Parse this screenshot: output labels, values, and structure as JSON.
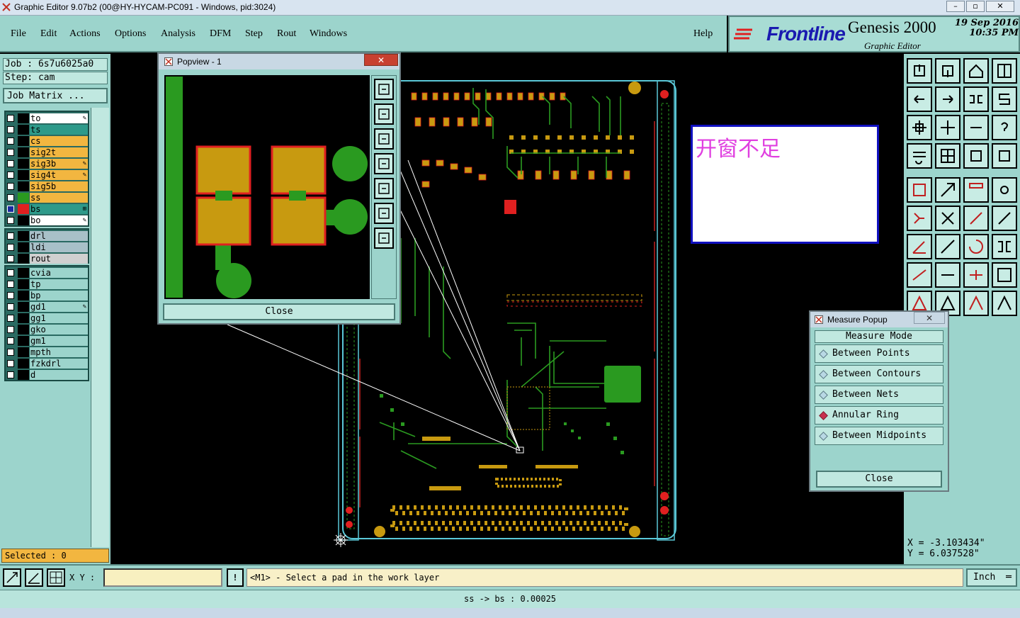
{
  "window": {
    "title": "Graphic Editor 9.07b2 (00@HY-HYCAM-PC091 - Windows, pid:3024)"
  },
  "menu": {
    "items": [
      "File",
      "Edit",
      "Actions",
      "Options",
      "Analysis",
      "DFM",
      "Step",
      "Rout",
      "Windows"
    ],
    "help": "Help"
  },
  "brand": {
    "logo": "Frontline",
    "product": "Genesis 2000",
    "subtitle": "Graphic Editor",
    "date": "19 Sep 2016",
    "time": "10:35 PM"
  },
  "job": {
    "job_label": "Job : 6s7u6025a0",
    "step_label": "Step: cam",
    "matrix_button": "Job Matrix ..."
  },
  "layers_group1": [
    {
      "name": "to",
      "color": "#ffffff",
      "swatch": "#000000",
      "mark": "brush"
    },
    {
      "name": "ts",
      "color": "#2e9a8a",
      "swatch": "#000000",
      "mark": ""
    },
    {
      "name": "cs",
      "color": "#f2b640",
      "swatch": "#000000",
      "mark": ""
    },
    {
      "name": "sig2t",
      "color": "#f2b640",
      "swatch": "#000000",
      "mark": ""
    },
    {
      "name": "sig3b",
      "color": "#f2b640",
      "swatch": "#000000",
      "mark": "brush"
    },
    {
      "name": "sig4t",
      "color": "#f2b640",
      "swatch": "#000000",
      "mark": "brush"
    },
    {
      "name": "sig5b",
      "color": "#f2b640",
      "swatch": "#000000",
      "mark": ""
    },
    {
      "name": "ss",
      "color": "#f2b640",
      "swatch": "#2a9a20",
      "mark": ""
    },
    {
      "name": "bs",
      "color": "#2e9a8a",
      "swatch": "#e02020",
      "mark": "grid"
    },
    {
      "name": "bo",
      "color": "#ffffff",
      "swatch": "#000000",
      "mark": "brush"
    }
  ],
  "layers_group2": [
    {
      "name": "drl",
      "color": "#a8c0c8",
      "mark": ""
    },
    {
      "name": "ldi",
      "color": "#a8c0c8",
      "mark": ""
    },
    {
      "name": "rout",
      "color": "#d0d0d0",
      "mark": ""
    }
  ],
  "layers_group3": [
    {
      "name": "cvia",
      "color": "#9cd4cc",
      "mark": ""
    },
    {
      "name": "tp",
      "color": "#9cd4cc",
      "mark": ""
    },
    {
      "name": "bp",
      "color": "#9cd4cc",
      "mark": ""
    },
    {
      "name": "gd1",
      "color": "#9cd4cc",
      "mark": "brush"
    },
    {
      "name": "gg1",
      "color": "#9cd4cc",
      "mark": ""
    },
    {
      "name": "gko",
      "color": "#9cd4cc",
      "mark": ""
    },
    {
      "name": "gm1",
      "color": "#9cd4cc",
      "mark": ""
    },
    {
      "name": "mpth",
      "color": "#9cd4cc",
      "mark": ""
    },
    {
      "name": "fzkdrl",
      "color": "#9cd4cc",
      "mark": ""
    },
    {
      "name": "d",
      "color": "#9cd4cc",
      "mark": ""
    }
  ],
  "selected": "Selected : 0",
  "popview": {
    "title": "Popview - 1",
    "close": "Close"
  },
  "measure": {
    "title": "Measure Popup",
    "header": "Measure Mode",
    "modes": [
      "Between Points",
      "Between Contours",
      "Between Nets",
      "Annular Ring",
      "Between Midpoints"
    ],
    "active": "Annular Ring",
    "close": "Close"
  },
  "annotation": {
    "text": "开窗不足"
  },
  "coords": {
    "x": "X = -3.103434\"",
    "y": "Y = 6.037528\""
  },
  "bottom": {
    "xy_label": "X Y :",
    "xy_value": "",
    "prompt": "<M1> - Select a pad in the work layer",
    "units": "Inch"
  },
  "status": {
    "message": "ss -> bs : 0.00025"
  },
  "colors": {
    "accent": "#9cd4cc",
    "trace": "#2a9a20",
    "pad": "#c89a10",
    "highlight": "#e02020"
  }
}
